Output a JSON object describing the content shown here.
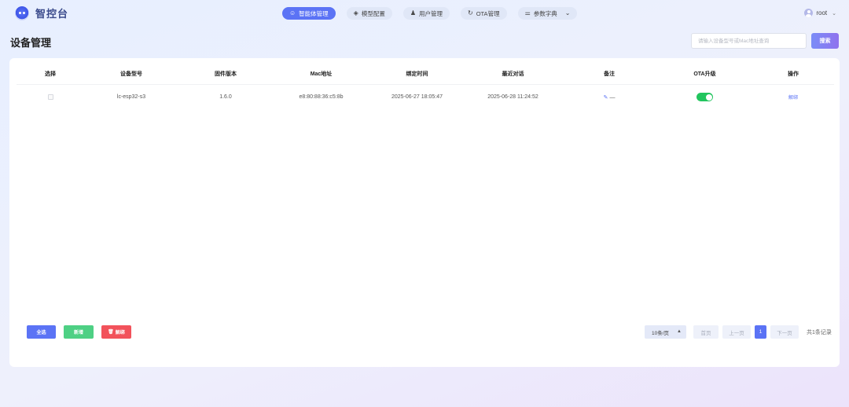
{
  "app": {
    "logo_text": "智控台"
  },
  "nav": [
    {
      "icon": "robot-icon",
      "label": "智能体管理",
      "active": true
    },
    {
      "icon": "layers-icon",
      "label": "模型配置",
      "active": false
    },
    {
      "icon": "user-icon",
      "label": "用户管理",
      "active": false
    },
    {
      "icon": "refresh-icon",
      "label": "OTA管理",
      "active": false
    },
    {
      "icon": "sliders-icon",
      "label": "参数字典",
      "active": false
    }
  ],
  "user": {
    "name": "root"
  },
  "page": {
    "title": "设备管理"
  },
  "search": {
    "placeholder": "请输入设备型号或Mac地址查询",
    "value": "",
    "button": "搜索"
  },
  "table": {
    "headers": [
      "选择",
      "设备型号",
      "固件版本",
      "Mac地址",
      "绑定时间",
      "最近对话",
      "备注",
      "OTA升级",
      "操作"
    ],
    "rows": [
      {
        "model": "lc-esp32-s3",
        "firmware": "1.6.0",
        "mac": "e8:80:88:36:c5:8b",
        "bind_time": "2025-06-27 18:05:47",
        "last_chat": "2025-06-28 11:24:52",
        "remark": "—",
        "ota_enabled": true,
        "action": "解绑"
      }
    ]
  },
  "actions": {
    "select_all": "全选",
    "add": "新增",
    "unbind": "解绑"
  },
  "pagination": {
    "page_size": "10条/页",
    "first": "首页",
    "prev": "上一页",
    "current": "1",
    "next": "下一页",
    "total": "共1条记录"
  },
  "colors": {
    "primary": "#5b73f5",
    "success": "#4ed084",
    "danger": "#f2525b",
    "toggle_on": "#22c55e"
  }
}
